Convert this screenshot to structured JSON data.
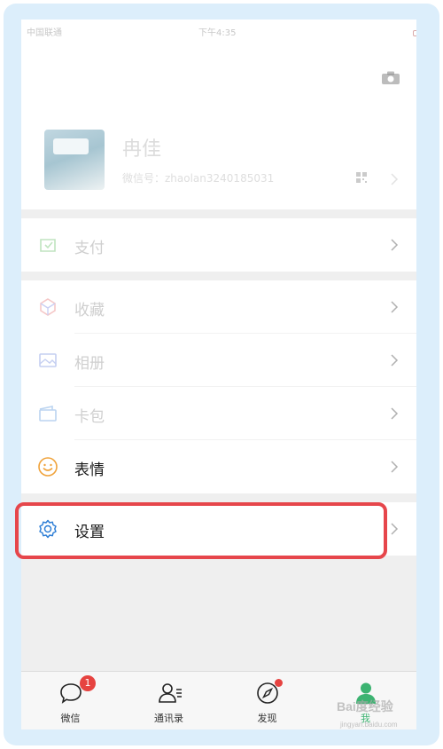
{
  "status_bar": {
    "carrier": "中国联通",
    "time": "下午4:35",
    "battery": ""
  },
  "profile": {
    "name": "冉佳",
    "wechat_id": "微信号：zhaolan3240185031"
  },
  "menu": {
    "pay": "支付",
    "favorites": "收藏",
    "album": "相册",
    "cards": "卡包",
    "stickers": "表情",
    "settings": "设置"
  },
  "tab_bar": {
    "chats": "微信",
    "chats_badge": "1",
    "contacts": "通讯录",
    "discover": "发现",
    "me": "我"
  },
  "watermark": {
    "brand": "Bai度经验",
    "url": "jingyan.baidu.com"
  },
  "colors": {
    "highlight": "#e6464b",
    "badge": "#e64340",
    "me_tab": "#3cb371"
  }
}
